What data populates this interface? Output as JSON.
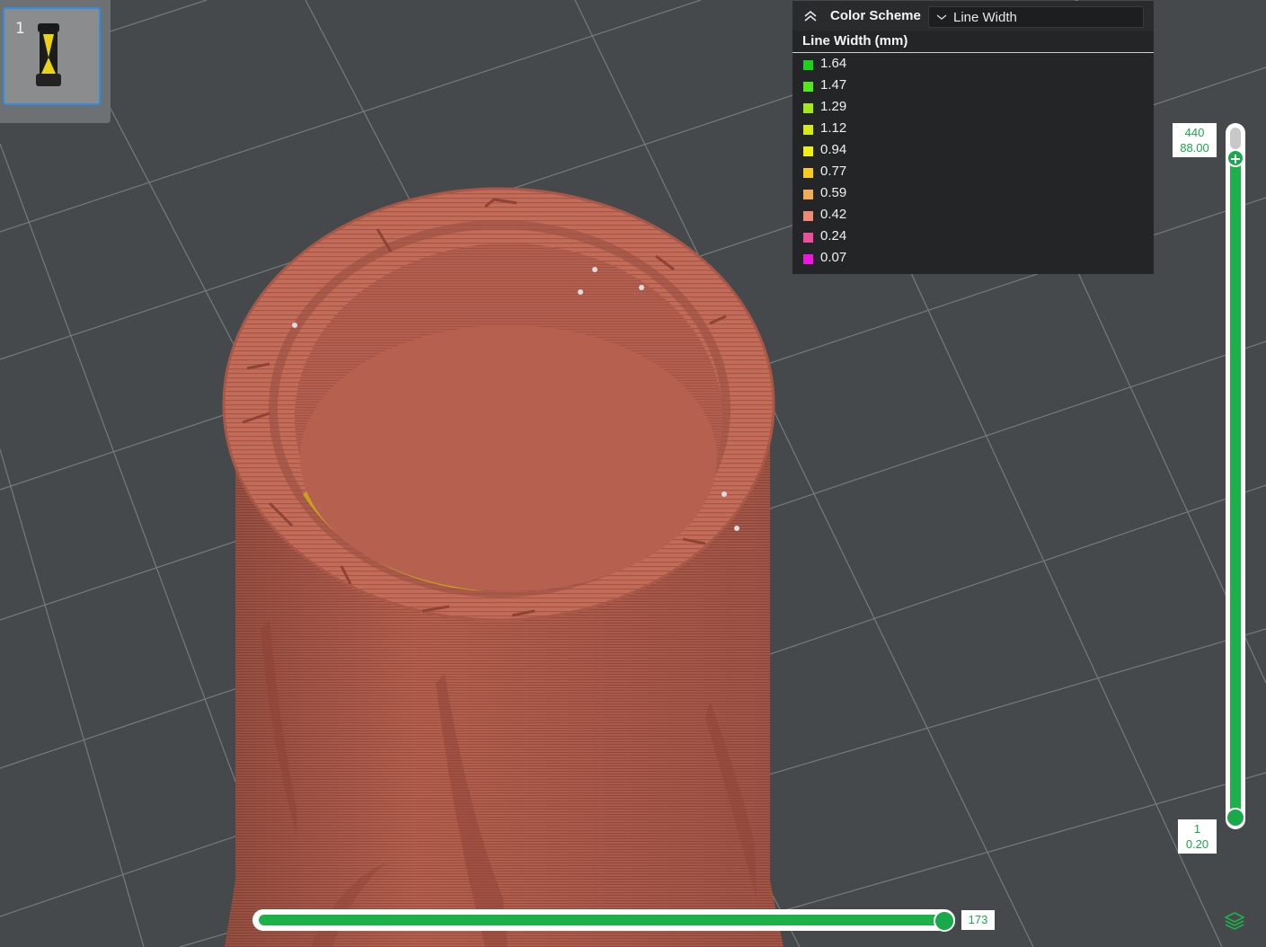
{
  "plate": {
    "number": "1"
  },
  "legend": {
    "scheme_label": "Color Scheme",
    "scheme_value": "Line Width",
    "title": "Line Width (mm)",
    "items": [
      {
        "value": "1.64",
        "color": "#1fd11f"
      },
      {
        "value": "1.47",
        "color": "#56e61c"
      },
      {
        "value": "1.29",
        "color": "#a4e81c"
      },
      {
        "value": "1.12",
        "color": "#d7ea18"
      },
      {
        "value": "0.94",
        "color": "#f2ef10"
      },
      {
        "value": "0.77",
        "color": "#f6cc1f"
      },
      {
        "value": "0.59",
        "color": "#f3ad57"
      },
      {
        "value": "0.42",
        "color": "#ee8976"
      },
      {
        "value": "0.24",
        "color": "#ec4f9b"
      },
      {
        "value": "0.07",
        "color": "#ec16dd"
      }
    ]
  },
  "layer_slider": {
    "top_layer": "440",
    "top_height": "88.00",
    "bottom_layer": "1",
    "bottom_height": "0.20"
  },
  "move_slider": {
    "value": "173"
  },
  "icons": {
    "collapse": "chevrons-up-icon",
    "dropdown": "chevron-down-icon",
    "layers": "layers-icon",
    "add": "plus-icon"
  },
  "colors": {
    "accent": "#1db14a",
    "model": "#b65e4f",
    "background": "#45494b",
    "legend_bg": "#242526",
    "selection": "#2f8de6"
  }
}
